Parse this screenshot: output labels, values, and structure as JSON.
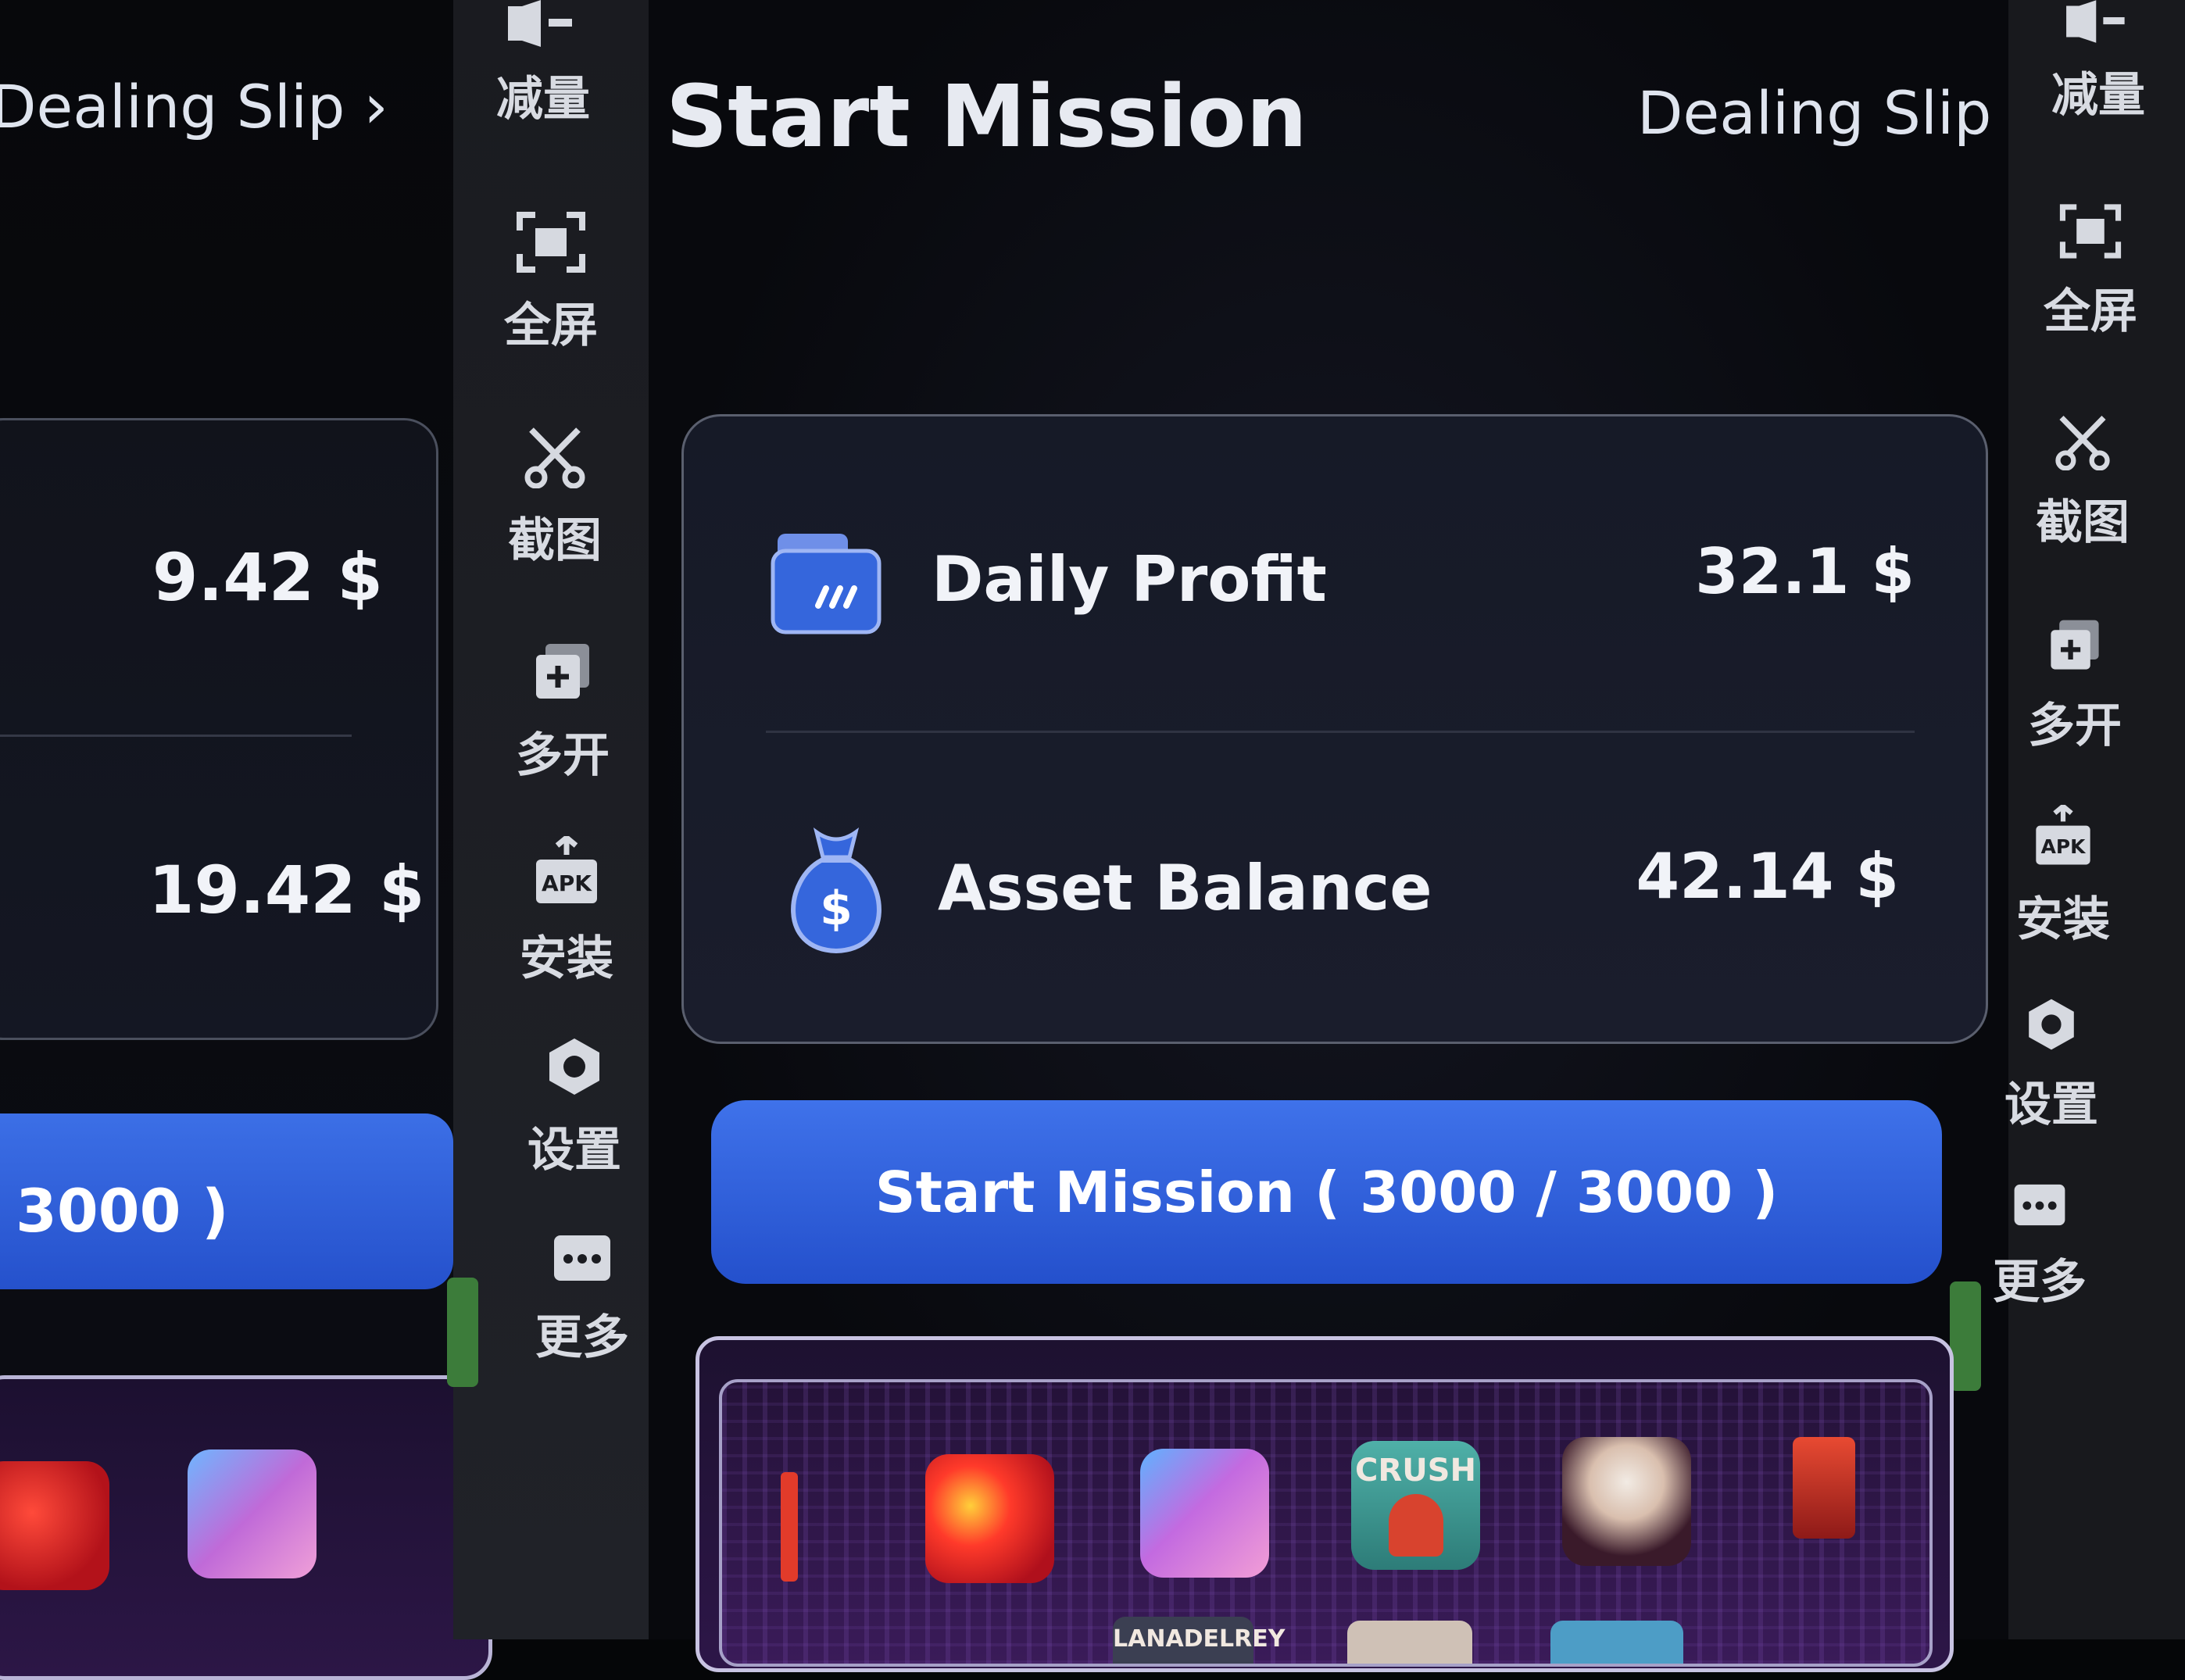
{
  "left_window": {
    "dealing_link": "Dealing Slip",
    "daily_profit_value": "9.42 $",
    "asset_balance_value": "19.42 $",
    "start_button_label": "3000 )"
  },
  "toolbar": {
    "items": [
      {
        "label": "减量",
        "icon": "volume-down-icon"
      },
      {
        "label": "全屏",
        "icon": "fullscreen-icon"
      },
      {
        "label": "截图",
        "icon": "scissors-icon"
      },
      {
        "label": "多开",
        "icon": "multi-open-icon"
      },
      {
        "label": "安装",
        "icon": "apk-install-icon"
      },
      {
        "label": "设置",
        "icon": "settings-icon"
      },
      {
        "label": "更多",
        "icon": "more-icon"
      }
    ]
  },
  "main_window": {
    "title": "Start Mission",
    "dealing_link": "Dealing Slip",
    "stats": {
      "daily_profit": {
        "label": "Daily Profit",
        "value": "32.1 $",
        "icon": "wallet-card-icon"
      },
      "asset_balance": {
        "label": "Asset Balance",
        "value": "42.14 $",
        "icon": "money-bag-icon"
      }
    },
    "start_button": "Start Mission ( 3000 / 3000 )",
    "app_tiles": [
      {
        "name": "red-abstract-cover"
      },
      {
        "name": "portrait-cover"
      },
      {
        "name": "crush-cover",
        "label": "CRUSH"
      },
      {
        "name": "white-figure-cover"
      },
      {
        "name": "red-poster-cover"
      }
    ],
    "lower_tile_label": "LANADELREY"
  },
  "colors": {
    "accent_blue": "#3563dd",
    "card_border": "#5a5f6e",
    "background": "#08090d"
  }
}
